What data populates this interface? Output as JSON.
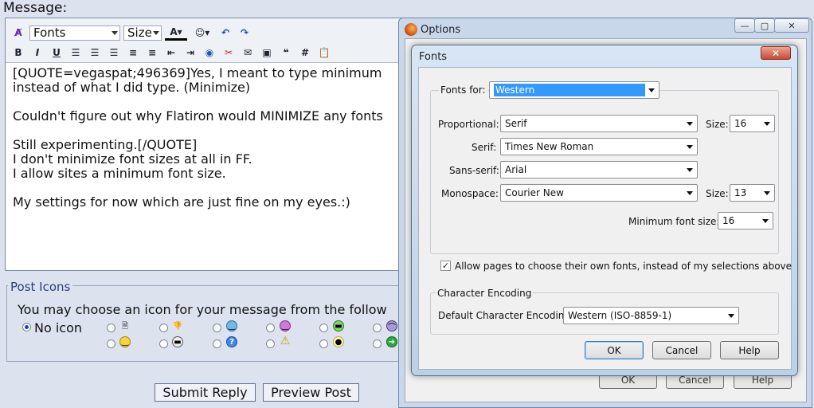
{
  "forum": {
    "message_label": "Message:",
    "font_select": "Fonts",
    "size_select": "Size",
    "toolbar_row1": [
      "bold",
      "italic",
      "underline"
    ],
    "toolbar_row2": [
      "B",
      "I",
      "U"
    ],
    "hash_button": "#",
    "text_lines": [
      "[QUOTE=vegaspat;496369]Yes, I meant to type minimum",
      "instead of what I did type. (Minimize)",
      "",
      "Couldn't figure out why Flatiron would MINIMIZE any fonts",
      "",
      "Still experimenting.[/QUOTE]",
      "I don't minimize font sizes at all in FF.",
      "I allow sites a minimum font size.",
      "",
      "My settings for now which are just fine on my eyes.:)"
    ],
    "post_icons_legend": "Post Icons",
    "post_icons_text": "You may choose an icon for your message from the follow",
    "no_icon_label": "No icon",
    "submit_button": "Submit Reply",
    "preview_button": "Preview Post"
  },
  "options_window": {
    "title": "Options",
    "minimize": "—",
    "maximize": "▢",
    "close": "✕",
    "ok_ghost": "OK",
    "cancel_ghost": "Cancel",
    "help_ghost": "Help"
  },
  "fonts_dialog": {
    "title": "Fonts",
    "close": "✕",
    "fonts_for_label": "Fonts for:",
    "fonts_for_value": "Western",
    "proportional_label": "Proportional:",
    "proportional_value": "Serif",
    "size_label": "Size:",
    "proportional_size": "16",
    "serif_label": "Serif:",
    "serif_value": "Times New Roman",
    "sans_serif_label": "Sans-serif:",
    "sans_serif_value": "Arial",
    "monospace_label": "Monospace:",
    "monospace_value": "Courier New",
    "monospace_size": "13",
    "min_font_label": "Minimum font size:",
    "min_font_value": "16",
    "allow_pages_label": "Allow pages to choose their own fonts, instead of my selections above",
    "allow_pages_checked": "✓",
    "char_encoding_group": "Character Encoding",
    "default_encoding_label": "Default Character Encoding:",
    "default_encoding_value": "Western (ISO-8859-1)",
    "ok_button": "OK",
    "cancel_button": "Cancel",
    "help_button": "Help"
  },
  "colors": {
    "selection": "#3399ff",
    "page_bg": "#dde3ee"
  }
}
